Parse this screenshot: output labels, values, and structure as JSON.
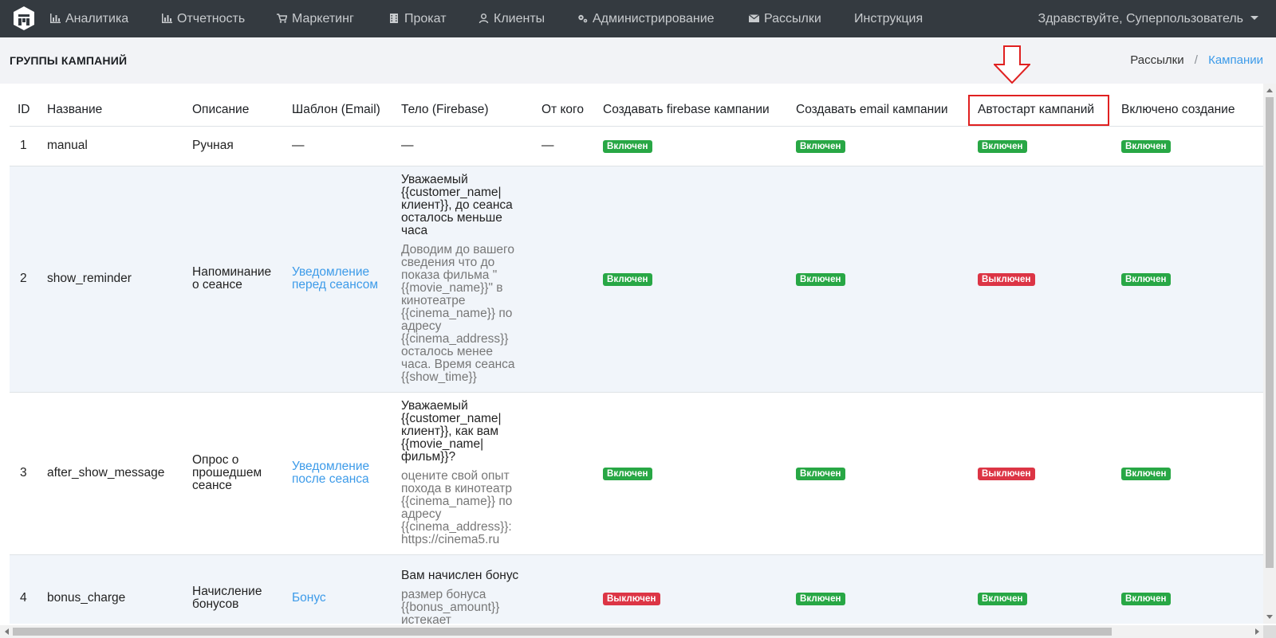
{
  "navbar": {
    "items": [
      {
        "label": "Аналитика",
        "icon": "bar-chart-icon"
      },
      {
        "label": "Отчетность",
        "icon": "bar-chart-icon"
      },
      {
        "label": "Маркетинг",
        "icon": "cart-icon"
      },
      {
        "label": "Прокат",
        "icon": "film-icon"
      },
      {
        "label": "Клиенты",
        "icon": "user-icon"
      },
      {
        "label": "Администрирование",
        "icon": "gears-icon"
      },
      {
        "label": "Рассылки",
        "icon": "envelope-icon"
      },
      {
        "label": "Инструкция",
        "icon": ""
      }
    ],
    "user_greeting": "Здравствуйте, Суперпользователь"
  },
  "header": {
    "title": "ГРУППЫ КАМПАНИЙ",
    "breadcrumb": {
      "parent": "Рассылки",
      "separator": "/",
      "current": "Кампании"
    }
  },
  "table": {
    "columns": {
      "id": "ID",
      "name": "Название",
      "description": "Описание",
      "template": "Шаблон (Email)",
      "body": "Тело (Firebase)",
      "from": "От кого",
      "create_firebase": "Создавать firebase кампании",
      "create_email": "Создавать email кампании",
      "autostart": "Автостарт кампаний",
      "enabled_creation": "Включено создание"
    },
    "rows": [
      {
        "id": "1",
        "name": "manual",
        "description": "Ручная",
        "template": "—",
        "body_title": "—",
        "body_text": "",
        "from": "—",
        "create_firebase": "Включен",
        "create_email": "Включен",
        "autostart": "Включен",
        "enabled_creation": "Включен"
      },
      {
        "id": "2",
        "name": "show_reminder",
        "description": "Напоминание о сеансе",
        "template": "Уведомление перед сеансом",
        "body_title": "Уважаемый {{customer_name|клиент}}, до сеанса осталось меньше часа",
        "body_text": "Доводим до вашего сведения что до показа фильма \"{{movie_name}}\" в кинотеатре {{cinema_name}} по адресу {{cinema_address}} осталось менее часа. Время сеанса {{show_time}}",
        "from": "",
        "create_firebase": "Включен",
        "create_email": "Включен",
        "autostart": "Выключен",
        "enabled_creation": "Включен"
      },
      {
        "id": "3",
        "name": "after_show_message",
        "description": "Опрос о прошедшем сеансе",
        "template": "Уведомление после сеанса",
        "body_title": "Уважаемый {{customer_name|клиент}}, как вам {{movie_name|фильм}}?",
        "body_text": "оцените свой опыт похода в кинотеатр {{cinema_name}} по адресу {{cinema_address}}: https://cinema5.ru",
        "from": "",
        "create_firebase": "Включен",
        "create_email": "Включен",
        "autostart": "Выключен",
        "enabled_creation": "Включен"
      },
      {
        "id": "4",
        "name": "bonus_charge",
        "description": "Начисление бонусов",
        "template": "Бонус",
        "body_title": "Вам начислен бонус",
        "body_text": "размер бонуса {{bonus_amount}} истекает",
        "from": "",
        "create_firebase": "Выключен",
        "create_email": "Включен",
        "autostart": "Включен",
        "enabled_creation": "Включен"
      }
    ]
  },
  "colors": {
    "navbar_bg": "#343a40",
    "badge_on": "#28a745",
    "badge_off": "#dc3545",
    "link": "#3d9be9",
    "annotation": "#e02020"
  }
}
